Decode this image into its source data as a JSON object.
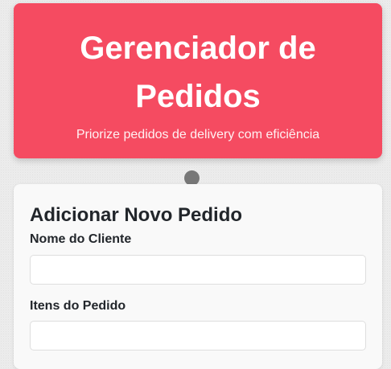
{
  "header": {
    "title": "Gerenciador de Pedidos",
    "subtitle": "Priorize pedidos de delivery com eficiência",
    "background_color": "#f54b61"
  },
  "form": {
    "title": "Adicionar Novo Pedido",
    "customer_name": {
      "label": "Nome do Cliente",
      "value": "",
      "placeholder": ""
    },
    "order_items": {
      "label": "Itens do Pedido",
      "value": "",
      "placeholder": ""
    }
  }
}
